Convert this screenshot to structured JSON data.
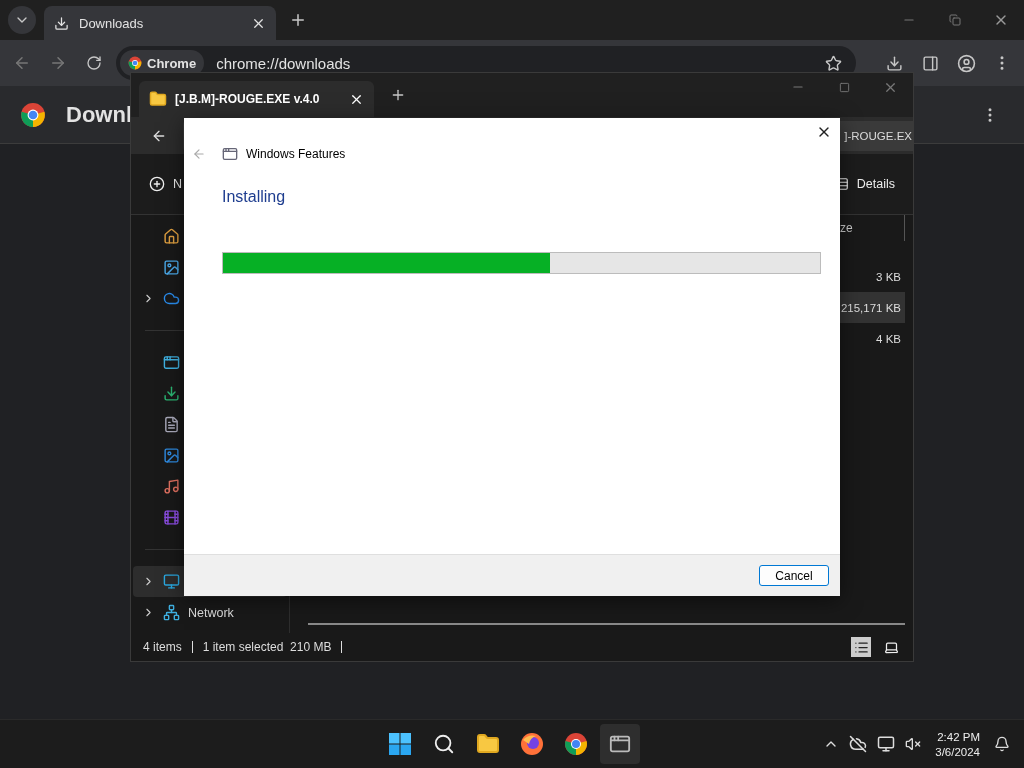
{
  "browser": {
    "tab": {
      "title": "Downloads"
    },
    "address": {
      "chip": "Chrome",
      "url": "chrome://downloads"
    },
    "page_title": "Downl"
  },
  "explorer": {
    "tab": {
      "title": "[J.B.M]-ROUGE.EXE v.4.0"
    },
    "path": "]-ROUGE.EX",
    "new_button": "N",
    "details_button": "Details",
    "column_header": "ze",
    "rows": [
      {
        "size": "3 KB",
        "selected": false
      },
      {
        "size": "215,171 KB",
        "selected": true
      },
      {
        "size": "4 KB",
        "selected": false
      }
    ],
    "nav": [
      {
        "kind": "home"
      },
      {
        "kind": "gallery"
      },
      {
        "kind": "cloud",
        "expandable": true
      },
      {
        "kind": "divider"
      },
      {
        "kind": "desktop"
      },
      {
        "kind": "downloads"
      },
      {
        "kind": "documents"
      },
      {
        "kind": "pictures"
      },
      {
        "kind": "music"
      },
      {
        "kind": "videos"
      },
      {
        "kind": "divider"
      },
      {
        "kind": "pc",
        "expandable": true,
        "selected": true
      },
      {
        "kind": "network",
        "label": "Network",
        "expandable": true,
        "selected": false
      }
    ],
    "status": {
      "items": "4 items",
      "selection": "1 item selected  210 MB"
    }
  },
  "dialog": {
    "title": "Windows Features",
    "heading": "Installing",
    "progress": {
      "level": 0.548
    },
    "cancel": "Cancel"
  },
  "taskbar": {
    "time": "2:42 PM",
    "date": "3/6/2024"
  }
}
